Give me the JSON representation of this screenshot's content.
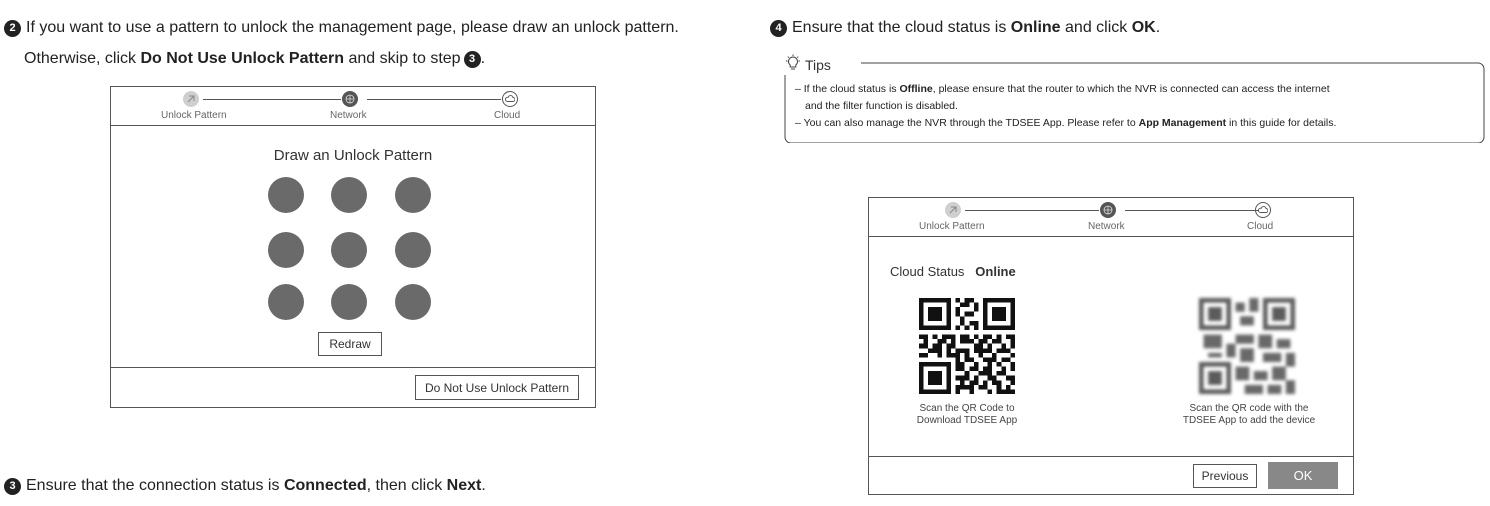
{
  "step2": {
    "number": "2",
    "line1": {
      "pre": "If you want to use a pattern to unlock the management page, please draw an unlock pattern."
    },
    "line2": {
      "pre": "Otherwise, click ",
      "bold": "Do Not Use Unlock Pattern",
      "post": " and skip to step",
      "ref": "3",
      "end": "."
    }
  },
  "step3": {
    "number": "3",
    "pre": "Ensure that the connection status is ",
    "bold1": "Connected",
    "mid": ", then click ",
    "bold2": "Next",
    "post": "."
  },
  "step4": {
    "number": "4",
    "pre": "Ensure that the cloud status is ",
    "bold1": "Online",
    "mid": " and click ",
    "bold2": "OK",
    "post": "."
  },
  "stepper": {
    "labels": [
      "Unlock Pattern",
      "Network",
      "Cloud"
    ]
  },
  "pattern_panel": {
    "title": "Draw an Unlock Pattern",
    "redraw_label": "Redraw",
    "skip_label": "Do Not Use Unlock Pattern"
  },
  "tips": {
    "title": "Tips",
    "line1": {
      "pre": "– If the cloud status is ",
      "bold": "Offline",
      "post": ", please ensure that the router to which the NVR is connected can access the internet"
    },
    "line2": "and the filter function is disabled.",
    "line3": {
      "pre": "– You can also manage the NVR through the TDSEE App. Please refer to ",
      "bold": "App Management",
      "post": " in this guide for details."
    }
  },
  "cloud_panel": {
    "status_label": "Cloud Status",
    "status_value": "Online",
    "qr1_caption": [
      "Scan the QR Code to",
      "Download TDSEE App"
    ],
    "qr2_caption": [
      "Scan the QR code with the",
      "TDSEE App to add the device"
    ],
    "previous_label": "Previous",
    "ok_label": "OK"
  },
  "colors": {
    "ok_button": "#888888",
    "dot": "#6a6a6a",
    "border": "#555555"
  }
}
